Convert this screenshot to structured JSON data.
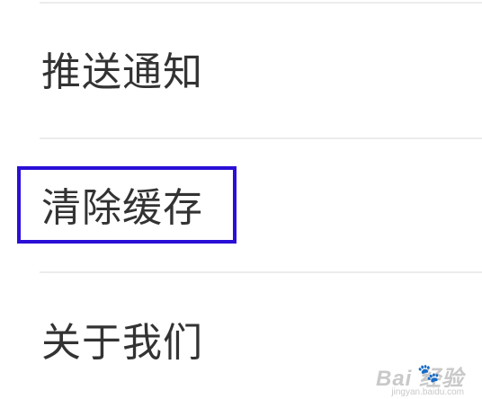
{
  "settings": {
    "items": [
      {
        "label": "推送通知"
      },
      {
        "label": "清除缓存",
        "highlighted": true
      },
      {
        "label": "关于我们"
      }
    ]
  },
  "highlight": {
    "color": "#2a0fd6"
  },
  "watermark": {
    "logo": "Bai  经验",
    "paw": "🐾",
    "domain": "jingyan.baidu.com"
  }
}
